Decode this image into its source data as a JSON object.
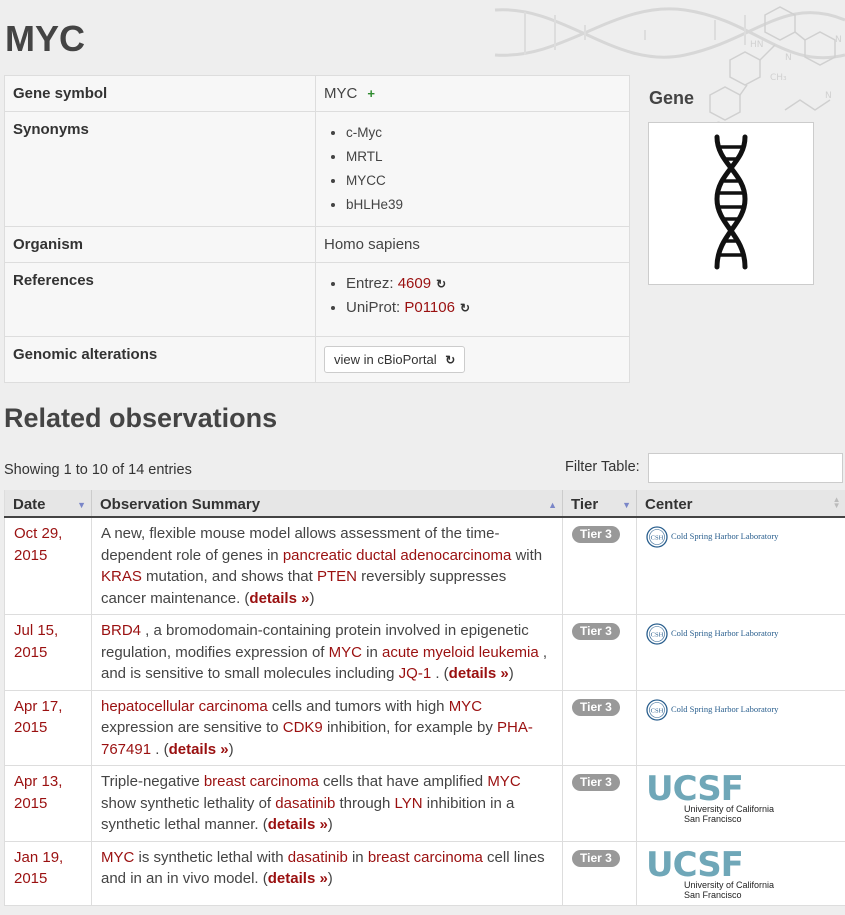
{
  "page": {
    "title": "MYC"
  },
  "gene_info": {
    "symbol_label": "Gene symbol",
    "symbol_value": "MYC",
    "add_symbol": "+",
    "synonyms_label": "Synonyms",
    "synonyms": [
      "c-Myc",
      "MRTL",
      "MYCC",
      "bHLHe39"
    ],
    "organism_label": "Organism",
    "organism_value": "Homo sapiens",
    "references_label": "References",
    "references": [
      {
        "prefix": "Entrez:",
        "id": "4609"
      },
      {
        "prefix": "UniProt:",
        "id": "P01106"
      }
    ],
    "genomic_label": "Genomic alterations",
    "cbio_button": "view in cBioPortal"
  },
  "gene_panel": {
    "heading": "Gene",
    "image_icon": "dna-double-helix-icon"
  },
  "related": {
    "heading": "Related observations",
    "showing": "Showing 1 to 10 of 14 entries",
    "filter_label": "Filter Table:",
    "filter_value": "",
    "columns": [
      "Date",
      "Observation Summary",
      "Tier",
      "Center"
    ],
    "rows": [
      {
        "date_line1": "Oct 29,",
        "date_line2": "2015",
        "summary": [
          {
            "t": "A new, flexible mouse model allows assessment of the time-dependent role of genes in "
          },
          {
            "t": "pancreatic ductal adenocarcinoma",
            "link": true
          },
          {
            "t": " with "
          },
          {
            "t": "KRAS",
            "link": true
          },
          {
            "t": " mutation, and shows that "
          },
          {
            "t": "PTEN",
            "link": true
          },
          {
            "t": " reversibly suppresses cancer maintenance. ("
          },
          {
            "t": "details »",
            "details": true
          },
          {
            "t": ")"
          }
        ],
        "tier": "Tier 3",
        "center": "Cold Spring Harbor Laboratory",
        "center_type": "csh"
      },
      {
        "date_line1": "Jul 15,",
        "date_line2": "2015",
        "summary": [
          {
            "t": "BRD4",
            "link": true
          },
          {
            "t": " , a bromodomain-containing protein involved in epigenetic regulation, modifies expression of "
          },
          {
            "t": "MYC",
            "link": true
          },
          {
            "t": " in "
          },
          {
            "t": "acute myeloid leukemia",
            "link": true
          },
          {
            "t": " , and is sensitive to small molecules including "
          },
          {
            "t": "JQ-1",
            "link": true
          },
          {
            "t": " . ("
          },
          {
            "t": "details »",
            "details": true
          },
          {
            "t": ")"
          }
        ],
        "tier": "Tier 3",
        "center": "Cold Spring Harbor Laboratory",
        "center_type": "csh"
      },
      {
        "date_line1": "Apr 17,",
        "date_line2": "2015",
        "summary": [
          {
            "t": "hepatocellular carcinoma",
            "link": true
          },
          {
            "t": " cells and tumors with high "
          },
          {
            "t": "MYC",
            "link": true
          },
          {
            "t": " expression are sensitive to "
          },
          {
            "t": "CDK9",
            "link": true
          },
          {
            "t": " inhibition, for example by "
          },
          {
            "t": "PHA-767491",
            "link": true
          },
          {
            "t": " . ("
          },
          {
            "t": "details »",
            "details": true
          },
          {
            "t": ")"
          }
        ],
        "tier": "Tier 3",
        "center": "Cold Spring Harbor Laboratory",
        "center_type": "csh"
      },
      {
        "date_line1": "Apr 13,",
        "date_line2": "2015",
        "summary": [
          {
            "t": "Triple-negative "
          },
          {
            "t": "breast carcinoma",
            "link": true
          },
          {
            "t": " cells that have amplified "
          },
          {
            "t": "MYC",
            "link": true
          },
          {
            "t": " show synthetic lethality of "
          },
          {
            "t": "dasatinib",
            "link": true
          },
          {
            "t": " through "
          },
          {
            "t": "LYN",
            "link": true
          },
          {
            "t": " inhibition in a synthetic lethal manner. ("
          },
          {
            "t": "details »",
            "details": true
          },
          {
            "t": ")"
          }
        ],
        "tier": "Tier 3",
        "center": "University of California San Francisco",
        "center_type": "ucsf"
      },
      {
        "date_line1": "Jan 19,",
        "date_line2": "2015",
        "summary": [
          {
            "t": "MYC",
            "link": true
          },
          {
            "t": " is synthetic lethal with "
          },
          {
            "t": "dasatinib",
            "link": true
          },
          {
            "t": " in "
          },
          {
            "t": "breast carcinoma",
            "link": true
          },
          {
            "t": " cell lines and in an in vivo model. ("
          },
          {
            "t": "details »",
            "details": true
          },
          {
            "t": ")"
          }
        ],
        "tier": "Tier 3",
        "center": "University of California San Francisco",
        "center_type": "ucsf"
      }
    ]
  },
  "logos": {
    "csh_mark": "CSH",
    "ucsf_mark": "UCSF",
    "ucsf_line1": "University of California",
    "ucsf_line2": "San Francisco"
  }
}
